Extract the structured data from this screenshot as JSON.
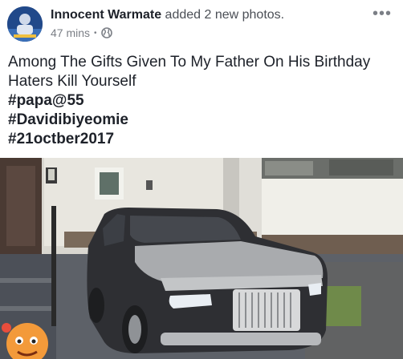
{
  "post": {
    "author": "Innocent Warmate",
    "action": "added 2 new photos.",
    "time": "47 mins",
    "more_label": "•••",
    "caption_lines": [
      "Among The Gifts Given To My Father On His Birthday",
      "Haters Kill Yourself"
    ],
    "hashtags": [
      "#papa@55",
      "#Davidibiyeomie",
      "#21octber2017"
    ]
  },
  "colors": {
    "author_text": "#1d2129",
    "meta_text": "#7b7f86",
    "car_body": "#2e2f33",
    "car_silver": "#a9abae"
  },
  "icons": {
    "privacy": "globe-icon",
    "more": "more-dots-icon"
  }
}
